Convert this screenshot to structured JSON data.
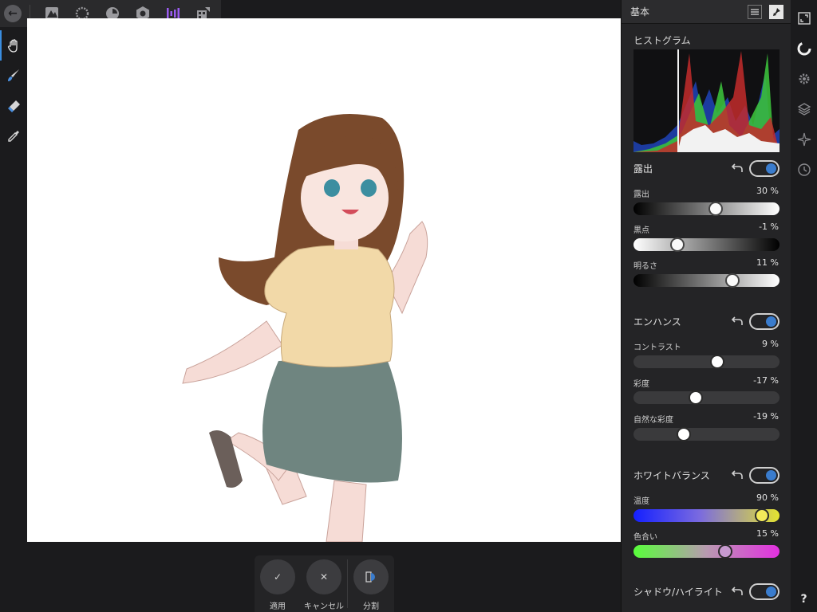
{
  "personas": [
    "photo-persona",
    "liquify-persona",
    "develop-persona",
    "tone-mapping-persona",
    "export-persona"
  ],
  "panel": {
    "title": "基本",
    "histogram_title": "ヒストグラム",
    "exposure_group": {
      "title": "露出",
      "enabled": true,
      "rows": [
        {
          "label": "露出",
          "value": "30 %",
          "fraction": 0.57
        },
        {
          "label": "黒点",
          "value": "-1 %",
          "fraction": 0.28
        },
        {
          "label": "明るさ",
          "value": "11 %",
          "fraction": 0.7
        }
      ]
    },
    "enhance_group": {
      "title": "エンハンス",
      "enabled": true,
      "rows": [
        {
          "label": "コントラスト",
          "value": "9 %",
          "fraction": 0.58
        },
        {
          "label": "彩度",
          "value": "-17 %",
          "fraction": 0.42
        },
        {
          "label": "自然な彩度",
          "value": "-19 %",
          "fraction": 0.33
        }
      ]
    },
    "white_balance_group": {
      "title": "ホワイトバランス",
      "enabled": true,
      "rows": [
        {
          "label": "温度",
          "value": "90 %",
          "fraction": 0.92
        },
        {
          "label": "色合い",
          "value": "15 %",
          "fraction": 0.64
        }
      ]
    },
    "shadow_highlight_group": {
      "title": "シャドウ/ハイライト",
      "enabled": true
    }
  },
  "context_toolbar": {
    "apply_label": "適用",
    "cancel_label": "キャンセル",
    "split_label": "分割",
    "apply_glyph": "✓",
    "cancel_glyph": "✕"
  },
  "studio_tabs": [
    "navigator-icon",
    "basic-adjust-icon",
    "settings-icon",
    "layers-icon",
    "focus-icon",
    "history-icon"
  ],
  "help_label": "?",
  "colors": {
    "accent": "#3a7ccd",
    "panel_bg": "#242426",
    "app_bg": "#1b1b1d",
    "persona_develop": "#9b5cf0"
  }
}
